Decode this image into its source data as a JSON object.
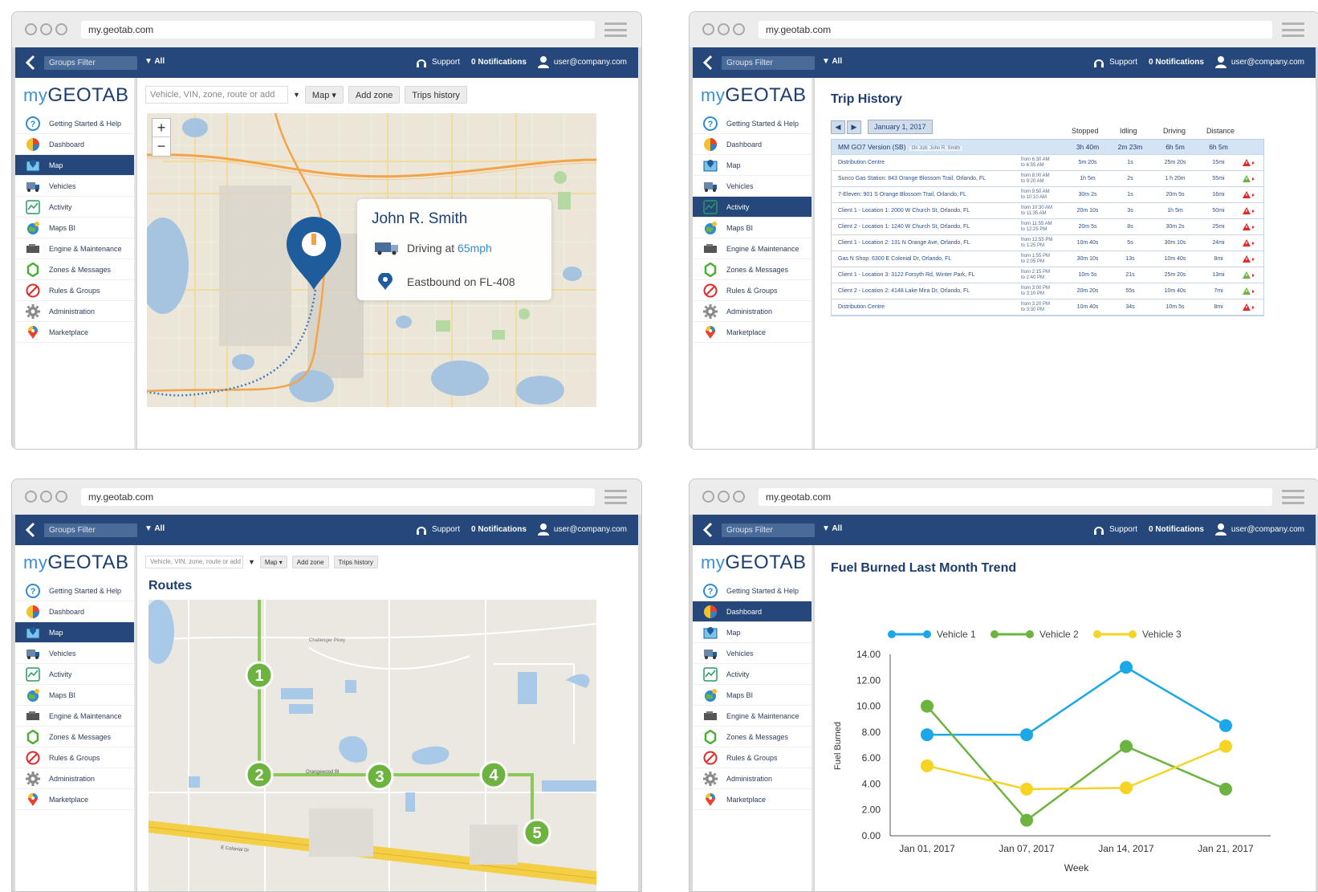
{
  "browser": {
    "url": "my.geotab.com"
  },
  "topbar": {
    "groups_filter": "Groups Filter",
    "all": "All",
    "support": "Support",
    "notifications": "0 Notifications",
    "user": "user@company.com"
  },
  "logo": {
    "my": "my",
    "brand": "GEOTAB"
  },
  "nav": [
    {
      "label": "Getting Started & Help",
      "icon": "help-icon"
    },
    {
      "label": "Dashboard",
      "icon": "dashboard-icon"
    },
    {
      "label": "Map",
      "icon": "map-icon"
    },
    {
      "label": "Vehicles",
      "icon": "truck-icon"
    },
    {
      "label": "Activity",
      "icon": "activity-icon"
    },
    {
      "label": "Maps BI",
      "icon": "globe-icon"
    },
    {
      "label": "Engine & Maintenance",
      "icon": "engine-icon"
    },
    {
      "label": "Zones & Messages",
      "icon": "zone-icon"
    },
    {
      "label": "Rules & Groups",
      "icon": "rules-icon"
    },
    {
      "label": "Administration",
      "icon": "gear-icon"
    },
    {
      "label": "Marketplace",
      "icon": "marketplace-icon"
    }
  ],
  "active_nav": {
    "w1": "Map",
    "w2": "Activity",
    "w3": "Map",
    "w4": "Dashboard"
  },
  "map_toolbar": {
    "search_placeholder": "Vehicle, VIN, zone, route or add",
    "map": "Map",
    "add_zone": "Add zone",
    "trips_history": "Trips history"
  },
  "map_popup": {
    "name": "John R. Smith",
    "driving_prefix": "Driving at ",
    "speed": "65mph",
    "direction": "Eastbound on FL-408"
  },
  "trip_history": {
    "title": "Trip History",
    "date": "January 1, 2017",
    "columns": [
      "Stopped",
      "Idling",
      "Driving",
      "Distance"
    ],
    "summary": {
      "device": "MM GO7 Version (SB)",
      "on_job": "On Job: John R. Smith",
      "stopped": "3h 40m",
      "idling": "2m 23m",
      "driving": "6h 5m",
      "distance": "6h 5m"
    },
    "rows": [
      {
        "name": "Distribution Centre",
        "from": "from 6:30 AM",
        "to": "to 6:55 AM",
        "stopped": "5m 20s",
        "idling": "1s",
        "driving": "25m 20s",
        "distance": "15mi",
        "warn": "red"
      },
      {
        "name": "Sunco Gas Station: 843 Orange Blossom Trail, Orlando, FL",
        "from": "from 8:00 AM",
        "to": "to 9:20 AM",
        "stopped": "1h 5m",
        "idling": "2s",
        "driving": "1 h 20m",
        "distance": "55mi",
        "warn": "green"
      },
      {
        "name": "7-Eleven: 901 S Orange Blossom Trail, Orlando, FL",
        "from": "from 9:50 AM",
        "to": "to 10:10 AM",
        "stopped": "30m 2s",
        "idling": "1s",
        "driving": "20m 5s",
        "distance": "16mi",
        "warn": "red"
      },
      {
        "name": "Client 1 - Location 1: 2000 W Church St, Orlando, FL",
        "from": "from 10:30 AM",
        "to": "to 11:35 AM",
        "stopped": "20m 10s",
        "idling": "3s",
        "driving": "1h 5m",
        "distance": "50mi",
        "warn": "red"
      },
      {
        "name": "Client 2 - Location 1: 1240 W Church St, Orlando, FL",
        "from": "from 11:55 AM",
        "to": "to 12:25 PM",
        "stopped": "20m 5s",
        "idling": "8s",
        "driving": "30m 2s",
        "distance": "25mi",
        "warn": "red"
      },
      {
        "name": "Client 1 - Location 2: 131 N Orange Ave, Orlando, FL",
        "from": "from 12:55 PM",
        "to": "to 1:25 PM",
        "stopped": "10m 40s",
        "idling": "5s",
        "driving": "30m 10s",
        "distance": "24mi",
        "warn": "red"
      },
      {
        "name": "Gas N Shop: 6300 E Colonial Dr, Orlando, FL",
        "from": "from 1:55 PM",
        "to": "to 2:05 PM",
        "stopped": "30m 10s",
        "idling": "13s",
        "driving": "10m 40s",
        "distance": "8mi",
        "warn": "red"
      },
      {
        "name": "Client 1 - Location 3: 3122 Forsyth Rd, Winter Park, FL",
        "from": "from 2:15 PM",
        "to": "to 2:40 PM",
        "stopped": "10m 5s",
        "idling": "21s",
        "driving": "25m 20s",
        "distance": "13mi",
        "warn": "green"
      },
      {
        "name": "Client 2 - Location 2: 4148 Lake Mira Dr, Orlando, FL",
        "from": "from 3:00 PM",
        "to": "to 3:10 PM",
        "stopped": "20m 20s",
        "idling": "55s",
        "driving": "10m 40s",
        "distance": "7mi",
        "warn": "green"
      },
      {
        "name": "Distribution Centre",
        "from": "from 3:20 PM",
        "to": "to 3:30 PM",
        "stopped": "10m 40s",
        "idling": "34s",
        "driving": "10m 5s",
        "distance": "8mi",
        "warn": "red"
      }
    ]
  },
  "routes": {
    "title": "Routes",
    "stops": [
      "1",
      "2",
      "3",
      "4",
      "5"
    ],
    "labels": {
      "challenger": "Challenger Pkwy",
      "colonial": "E Colonial Dr",
      "orangewood": "Orangewood Bl"
    }
  },
  "colors": {
    "nav_bg": "#25477a",
    "accent_blue": "#3a8fd6",
    "route_green": "#7bc142",
    "stop_green": "#6db33f",
    "vehicle1": "#1ba7e8",
    "vehicle2": "#6db33f",
    "vehicle3": "#f5d423"
  },
  "chart_data": {
    "type": "line",
    "title": "Fuel Burned Last Month Trend",
    "xlabel": "Week",
    "ylabel": "Fuel Burned",
    "categories": [
      "Jan 01, 2017",
      "Jan 07, 2017",
      "Jan 14, 2017",
      "Jan 21, 2017"
    ],
    "ylim": [
      0,
      14
    ],
    "yticks": [
      "0.00",
      "2.00",
      "4.00",
      "6.00",
      "8.00",
      "10.00",
      "12.00",
      "14.00"
    ],
    "legend_position": "top",
    "grid": false,
    "series": [
      {
        "name": "Vehicle 1",
        "color": "#1ba7e8",
        "values": [
          7.8,
          7.8,
          13.0,
          8.5
        ]
      },
      {
        "name": "Vehicle 2",
        "color": "#6db33f",
        "values": [
          10.0,
          1.2,
          6.9,
          3.6
        ]
      },
      {
        "name": "Vehicle 3",
        "color": "#f5d423",
        "values": [
          5.4,
          3.6,
          3.7,
          6.9
        ]
      }
    ]
  }
}
